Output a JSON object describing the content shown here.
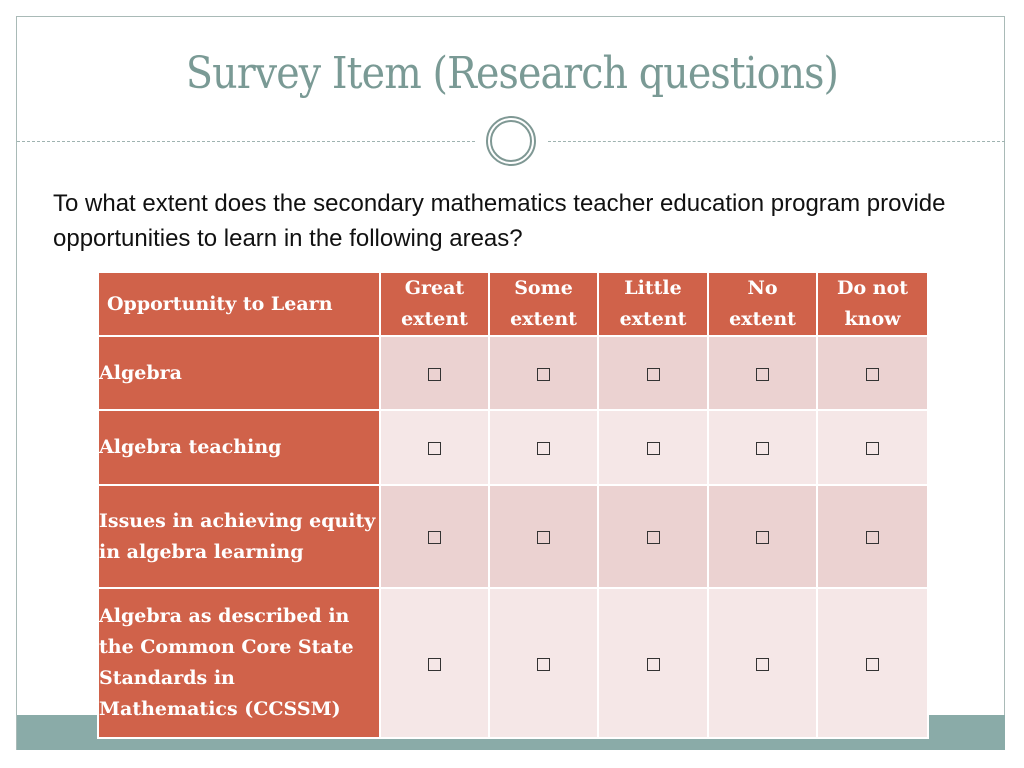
{
  "slide": {
    "title": "Survey Item (Research questions)",
    "question": "To what extent does the secondary mathematics teacher education program provide opportunities to learn in the following areas?"
  },
  "table": {
    "row_header": "Opportunity to Learn",
    "columns": [
      {
        "line1": "Great",
        "line2": "extent"
      },
      {
        "line1": "Some",
        "line2": "extent"
      },
      {
        "line1": "Little",
        "line2": "extent"
      },
      {
        "line1": "No",
        "line2": "extent"
      },
      {
        "line1": "Do not",
        "line2": "know"
      }
    ],
    "rows": [
      {
        "label": "Algebra",
        "checked": [
          false,
          false,
          false,
          false,
          false
        ]
      },
      {
        "label": "Algebra teaching",
        "checked": [
          false,
          false,
          false,
          false,
          false
        ]
      },
      {
        "label": "Issues in achieving equity in algebra learning",
        "checked": [
          false,
          false,
          false,
          false,
          false
        ]
      },
      {
        "label": "Algebra as described in the Common Core State Standards in Mathematics (CCSSM)",
        "checked": [
          false,
          false,
          false,
          false,
          false
        ]
      }
    ],
    "checkbox_glyph": "☐"
  },
  "colors": {
    "title": "#7a9a95",
    "header_bg": "#d0624a",
    "row_odd_bg": "#ebd2d1",
    "row_even_bg": "#f5e7e7",
    "band": "#8aaba8"
  }
}
